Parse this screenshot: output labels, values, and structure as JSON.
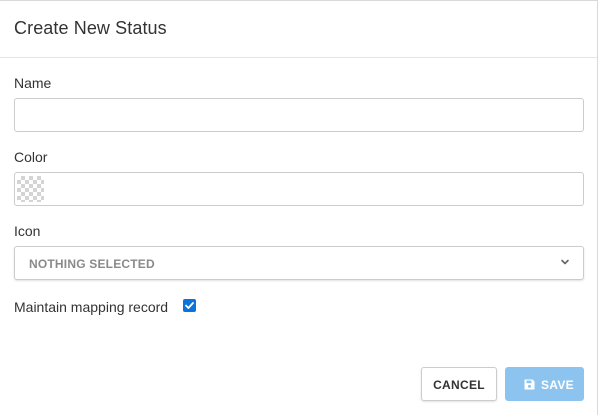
{
  "dialog": {
    "title": "Create New Status"
  },
  "form": {
    "name": {
      "label": "Name",
      "value": "",
      "placeholder": ""
    },
    "color": {
      "label": "Color",
      "value": "",
      "swatch": "transparent"
    },
    "icon": {
      "label": "Icon",
      "selected": "NOTHING SELECTED"
    },
    "maintain_mapping": {
      "label": "Maintain mapping record",
      "checked": true
    }
  },
  "buttons": {
    "cancel_label": "CANCEL",
    "save_label": "SAVE"
  },
  "colors": {
    "checkbox": "#0b73d9",
    "save_button": "#8cc4ef",
    "border": "#cccccc"
  },
  "icons": {
    "icon_select_caret": "chevron-down-icon",
    "save_button_icon": "floppy-disk-icon",
    "checkbox_mark": "checkmark-icon"
  }
}
